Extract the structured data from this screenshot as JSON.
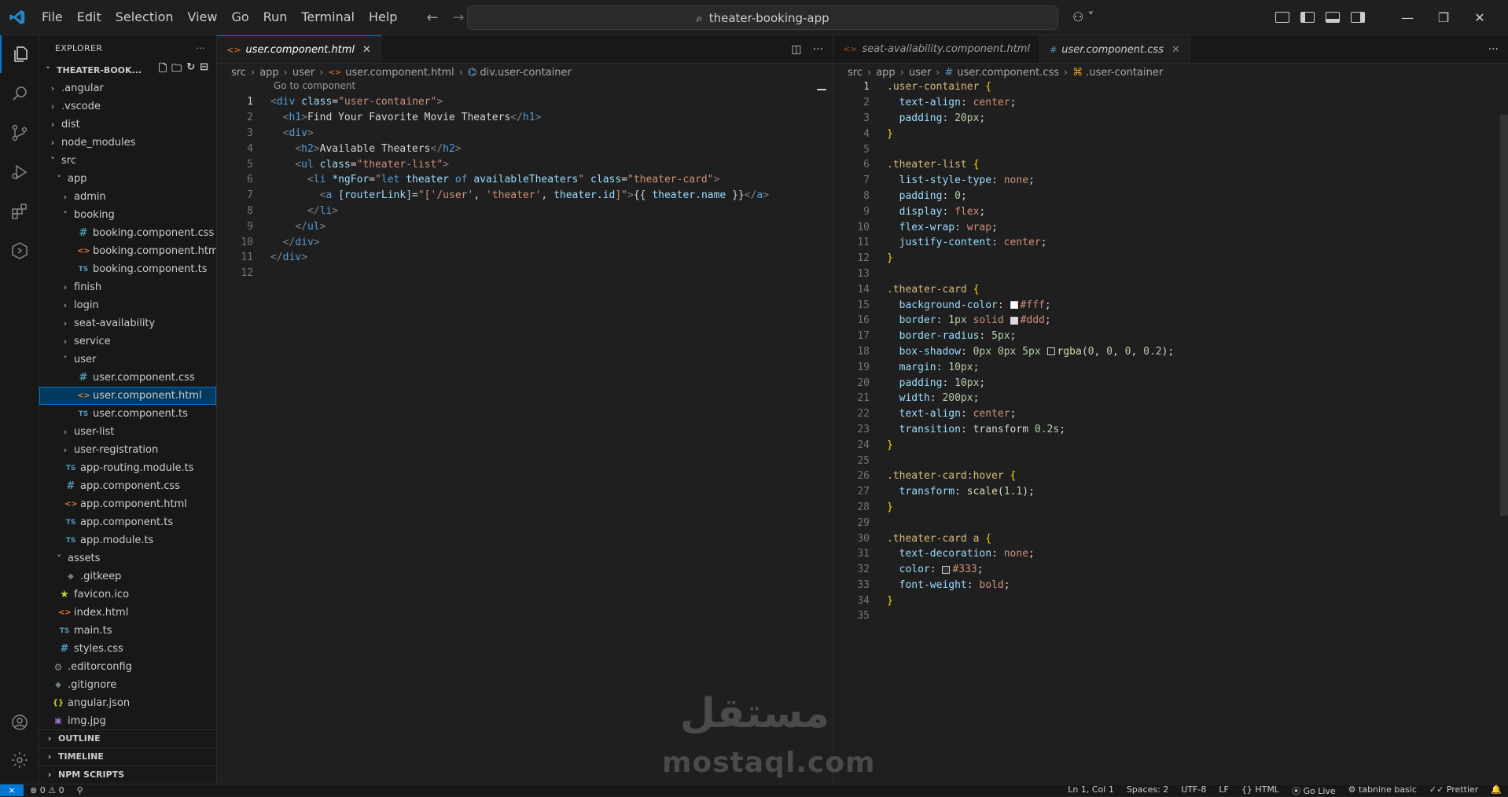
{
  "titlebar": {
    "menu": [
      "File",
      "Edit",
      "Selection",
      "View",
      "Go",
      "Run",
      "Terminal",
      "Help"
    ],
    "search_text": "theater-booking-app"
  },
  "sidebar": {
    "title": "EXPLORER",
    "project": "THEATER-BOOK...",
    "tree": [
      {
        "label": ".angular",
        "depth": 0,
        "type": "folder",
        "open": false
      },
      {
        "label": ".vscode",
        "depth": 0,
        "type": "folder",
        "open": false
      },
      {
        "label": "dist",
        "depth": 0,
        "type": "folder",
        "open": false
      },
      {
        "label": "node_modules",
        "depth": 0,
        "type": "folder",
        "open": false
      },
      {
        "label": "src",
        "depth": 0,
        "type": "folder",
        "open": true
      },
      {
        "label": "app",
        "depth": 1,
        "type": "folder",
        "open": true
      },
      {
        "label": "admin",
        "depth": 2,
        "type": "folder",
        "open": false
      },
      {
        "label": "booking",
        "depth": 2,
        "type": "folder",
        "open": true
      },
      {
        "label": "booking.component.css",
        "depth": 3,
        "type": "css"
      },
      {
        "label": "booking.component.html",
        "depth": 3,
        "type": "html"
      },
      {
        "label": "booking.component.ts",
        "depth": 3,
        "type": "ts"
      },
      {
        "label": "finish",
        "depth": 2,
        "type": "folder",
        "open": false
      },
      {
        "label": "login",
        "depth": 2,
        "type": "folder",
        "open": false
      },
      {
        "label": "seat-availability",
        "depth": 2,
        "type": "folder",
        "open": false
      },
      {
        "label": "service",
        "depth": 2,
        "type": "folder",
        "open": false
      },
      {
        "label": "user",
        "depth": 2,
        "type": "folder",
        "open": true
      },
      {
        "label": "user.component.css",
        "depth": 3,
        "type": "css"
      },
      {
        "label": "user.component.html",
        "depth": 3,
        "type": "html",
        "selected": true
      },
      {
        "label": "user.component.ts",
        "depth": 3,
        "type": "ts"
      },
      {
        "label": "user-list",
        "depth": 2,
        "type": "folder",
        "open": false
      },
      {
        "label": "user-registration",
        "depth": 2,
        "type": "folder",
        "open": false
      },
      {
        "label": "app-routing.module.ts",
        "depth": 2,
        "type": "ts",
        "flat": true
      },
      {
        "label": "app.component.css",
        "depth": 2,
        "type": "css",
        "flat": true
      },
      {
        "label": "app.component.html",
        "depth": 2,
        "type": "html",
        "flat": true
      },
      {
        "label": "app.component.ts",
        "depth": 2,
        "type": "ts",
        "flat": true
      },
      {
        "label": "app.module.ts",
        "depth": 2,
        "type": "ts",
        "flat": true
      },
      {
        "label": "assets",
        "depth": 1,
        "type": "folder",
        "open": true
      },
      {
        "label": ".gitkeep",
        "depth": 2,
        "type": "diamond",
        "flat": true
      },
      {
        "label": "favicon.ico",
        "depth": 1,
        "type": "star",
        "flat": true
      },
      {
        "label": "index.html",
        "depth": 1,
        "type": "html",
        "flat": true
      },
      {
        "label": "main.ts",
        "depth": 1,
        "type": "ts",
        "flat": true
      },
      {
        "label": "styles.css",
        "depth": 1,
        "type": "css",
        "flat": true
      },
      {
        "label": ".editorconfig",
        "depth": 0,
        "type": "gear",
        "flat": true
      },
      {
        "label": ".gitignore",
        "depth": 0,
        "type": "diamond",
        "flat": true
      },
      {
        "label": "angular.json",
        "depth": 0,
        "type": "json",
        "flat": true
      },
      {
        "label": "img.jpg",
        "depth": 0,
        "type": "img",
        "flat": true
      }
    ],
    "sections": [
      "OUTLINE",
      "TIMELINE",
      "NPM SCRIPTS"
    ]
  },
  "editor_left": {
    "tab": "user.component.html",
    "breadcrumb": [
      "src",
      "app",
      "user",
      "user.component.html",
      "div.user-container"
    ],
    "codelens": "Go to component"
  },
  "editor_right": {
    "tabs": [
      "seat-availability.component.html",
      "user.component.css"
    ],
    "breadcrumb": [
      "src",
      "app",
      "user",
      "user.component.css",
      ".user-container"
    ]
  },
  "watermark": {
    "ar": "مستقل",
    "en": "mostaql.com"
  },
  "statusbar": {
    "problems": "0",
    "warnings": "0",
    "position": "Ln 1, Col 1",
    "spaces": "Spaces: 2",
    "encoding": "UTF-8",
    "eol": "LF",
    "language": "HTML",
    "golive": "Go Live",
    "tabnine": "tabnine basic",
    "prettier": "Prettier"
  }
}
